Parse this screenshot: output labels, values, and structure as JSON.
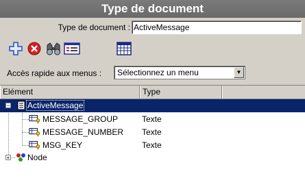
{
  "window": {
    "title": "Type de document"
  },
  "doctype": {
    "label": "Type de document :",
    "value": "ActiveMessage"
  },
  "toolbar": {
    "buttons": [
      {
        "icon": "add-icon"
      },
      {
        "icon": "delete-icon"
      },
      {
        "icon": "binoculars-icon"
      },
      {
        "icon": "properties-icon"
      },
      {
        "icon": "table-icon"
      }
    ]
  },
  "quickaccess": {
    "label": "Accès rapide aux menus :",
    "selected": "Sélectionnez un menu"
  },
  "tree": {
    "columns": [
      "Elément",
      "Type"
    ],
    "root": "ActiveMessage",
    "rows": [
      {
        "name": "MESSAGE_GROUP",
        "type": "Texte"
      },
      {
        "name": "MESSAGE_NUMBER",
        "type": "Texte"
      },
      {
        "name": "MSG_KEY",
        "type": "Texte"
      }
    ],
    "node": "Node"
  },
  "colors": {
    "selection": "#0a246a",
    "titlebar": "#6e6e6e",
    "chrome": "#d4d0c8"
  }
}
